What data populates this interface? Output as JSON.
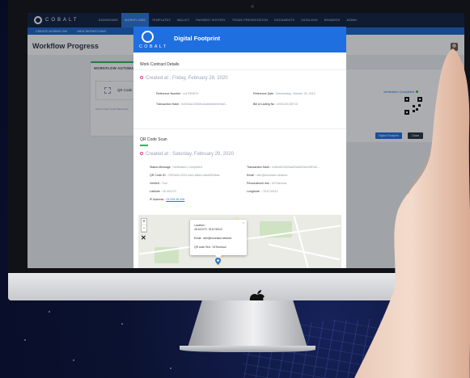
{
  "app": {
    "brand": "COBALT",
    "nav_items": [
      "DASHBOARD",
      "WORKFLOWS",
      "TEMPLATES",
      "WALLET",
      "PAYMENT HISTORY",
      "TRADE PRESENTATION",
      "DOCUMENTS",
      "CATALOGS",
      "REWARDS",
      "ADMIN"
    ],
    "active_nav": "WORKFLOWS",
    "subnav_items": [
      "CREATE WORKFLOW",
      "VIEW WORKFLOWS"
    ],
    "page_title": "Workflow Progress"
  },
  "background_page": {
    "panel_title": "WORKFLOW AUTOMA",
    "qr_scan_label": "QR Code Sc",
    "footer_link": "Click to Open Gold Value Flow",
    "verification_label": "Verification Completed",
    "digital_footprint_button": "Digital Footprint",
    "close_button": "Close"
  },
  "modal": {
    "brand": "COBALT",
    "title": "Digital Footprint",
    "work_contract": {
      "section_title": "Work Contract Details",
      "created_label": "Created at : Friday, February 28, 2020",
      "fields": [
        {
          "label": "Reference Number : ",
          "value": "ros7f393f7e"
        },
        {
          "label": "Reference Date : ",
          "value": "Wednesday, October 30, 2019"
        },
        {
          "label": "Transaction Hash : ",
          "value": "0x0f2da1305b9c2ad4b8c6e4b3a0..."
        },
        {
          "label": "Bill of Lading No : ",
          "value": "#200130135713"
        }
      ]
    },
    "qr_scan": {
      "section_title": "QR Code Scan",
      "created_label": "Created at : Saturday, February 29, 2020",
      "fields": [
        {
          "label": "Status Message : ",
          "value": "Verification Completed"
        },
        {
          "label": "Transaction Hash : ",
          "value": "0x6f4d01502bad33a8533ee28f7a0..."
        },
        {
          "label": "QR Code ID : ",
          "value": "752040b-2333-44ec-a8a3-cdea0003bac"
        },
        {
          "label": "Email : ",
          "value": "clier@innuhaus.network"
        },
        {
          "label": "Verified : ",
          "value": "True"
        },
        {
          "label": "Personalized Info : ",
          "value": "007bchnuw"
        },
        {
          "label": "Latitude : ",
          "value": "45.431270"
        },
        {
          "label": "Longitude : ",
          "value": "-76.6749112"
        },
        {
          "label": "IP Address : ",
          "value": "23.235.26.206"
        }
      ]
    },
    "map": {
      "zoom_in": "+",
      "zoom_out": "−",
      "fullscreen": "✕",
      "popup_close": "×",
      "popup_location": "Location :",
      "popup_coords": "45.431270 -76.6749112",
      "popup_email": "Email : clier@innuhaus.network",
      "popup_qr": "QR code Text : 007bchnuw"
    }
  },
  "icons": {
    "apple": "apple-logo-icon",
    "marker": "map-marker-icon",
    "scan": "qr-scan-icon"
  },
  "colors": {
    "nav_bg": "#0e1f3d",
    "accent_blue": "#1f6fe0",
    "success_green": "#2eb35a",
    "created_marker": "#e04a8c"
  }
}
